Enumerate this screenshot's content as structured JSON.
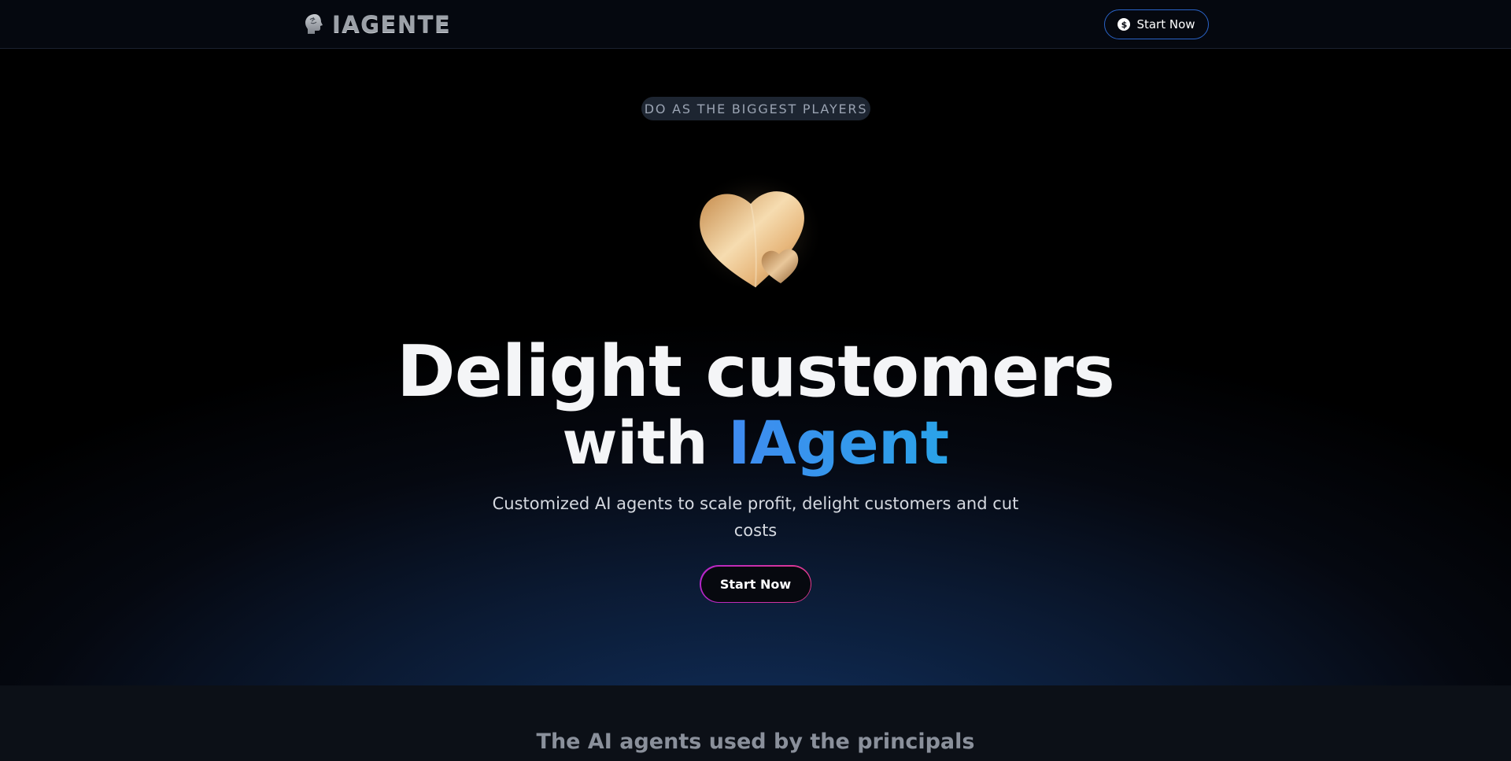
{
  "navbar": {
    "logo_text": "IAGENTE",
    "logo_icon": "brain-head-icon",
    "cta_label": "Start Now",
    "cta_icon": "dollar-icon"
  },
  "hero": {
    "eyebrow": "DO AS THE BIGGEST PLAYERS",
    "illustration": "gold-hearts-icon",
    "headline_line1": "Delight customers",
    "headline_line2_prefix": "with",
    "headline_line2_accent": "IAgent",
    "subheadline": "Customized AI agents to scale profit, delight customers and cut costs",
    "cta_label": "Start Now"
  },
  "section2": {
    "title": "The AI agents used by the principals"
  },
  "colors": {
    "accent_blue": "#3f8bf0",
    "cta_border_start": "#b425c9",
    "cta_border_end": "#e23a8e",
    "nav_cta_border": "#2a63c7",
    "background": "#000000"
  }
}
